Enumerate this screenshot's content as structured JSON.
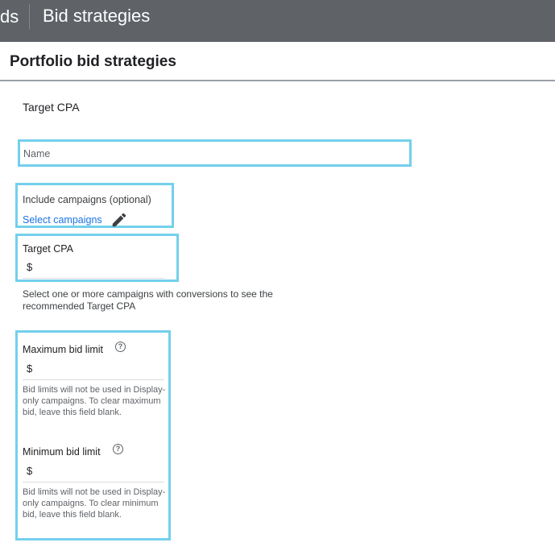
{
  "topbar": {
    "app_fragment": "ds",
    "page_title": "Bid strategies"
  },
  "subheader": {
    "title": "Portfolio bid strategies"
  },
  "strategy": {
    "type": "Target CPA"
  },
  "name_field": {
    "placeholder": "Name",
    "value": ""
  },
  "campaigns": {
    "label": "Include campaigns (optional)",
    "link": "Select campaigns",
    "edit_icon": "pencil-icon"
  },
  "target_cpa": {
    "label": "Target CPA",
    "currency": "$",
    "value": ""
  },
  "hint": "Select one or more campaigns with conversions to see the recommended Target CPA",
  "max_bid": {
    "label": "Maximum bid limit",
    "help_icon": "help-circle-icon",
    "currency": "$",
    "value": "",
    "note": "Bid limits will not be used in Display-only campaigns. To clear maximum bid, leave this field blank."
  },
  "min_bid": {
    "label": "Minimum bid limit",
    "help_icon": "help-circle-icon",
    "currency": "$",
    "value": "",
    "note": "Bid limits will not be used in Display-only campaigns. To clear minimum bid, leave this field blank."
  },
  "colors": {
    "topbar": "#5f6368",
    "highlight": "#73d0ec",
    "link": "#1a73e8"
  }
}
